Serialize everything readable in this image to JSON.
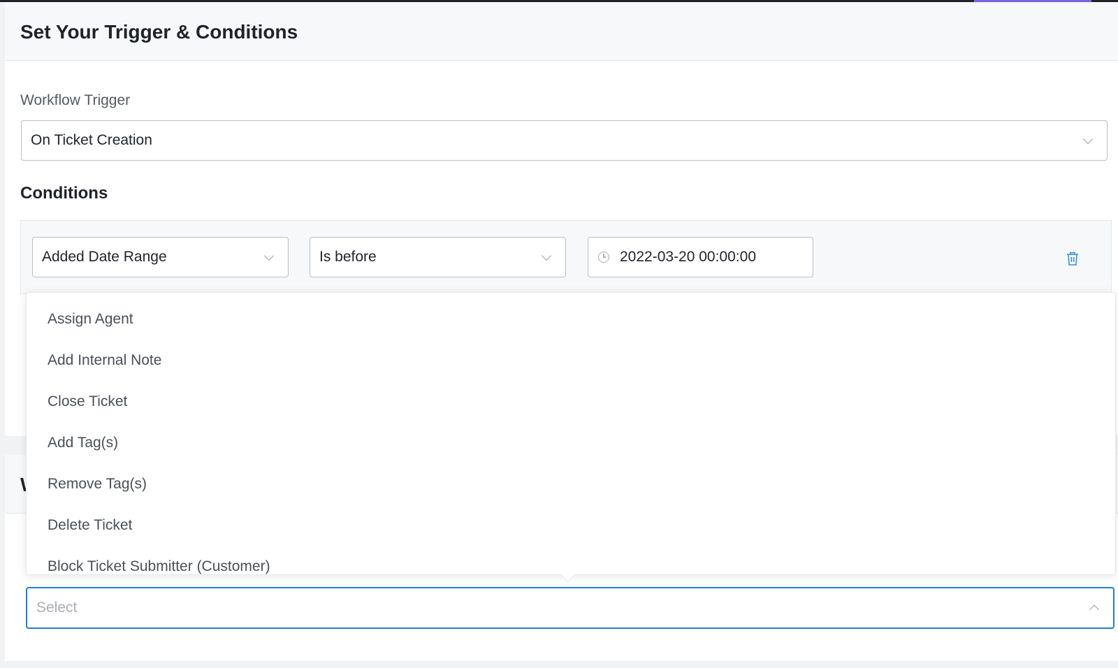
{
  "header": {
    "title": "Set Your Trigger & Conditions"
  },
  "trigger": {
    "label": "Workflow Trigger",
    "value": "On Ticket Creation"
  },
  "conditions": {
    "title": "Conditions",
    "rows": [
      {
        "field": "Added Date Range",
        "operator": "Is before",
        "value": "2022-03-20 00:00:00"
      }
    ]
  },
  "actions_section": {
    "title": "W"
  },
  "actions_dropdown": {
    "options": [
      "Assign Agent",
      "Add Internal Note",
      "Close Ticket",
      "Add Tag(s)",
      "Remove Tag(s)",
      "Delete Ticket",
      "Block Ticket Submitter (Customer)"
    ],
    "placeholder": "Select"
  },
  "colors": {
    "accent": "#1f7fd8",
    "topbar_accent": "#7b61e8",
    "delete_icon": "#3a8de0"
  },
  "icons": {
    "chevron": "chevron-down-icon",
    "clock": "clock-icon",
    "delete": "trash-icon"
  }
}
